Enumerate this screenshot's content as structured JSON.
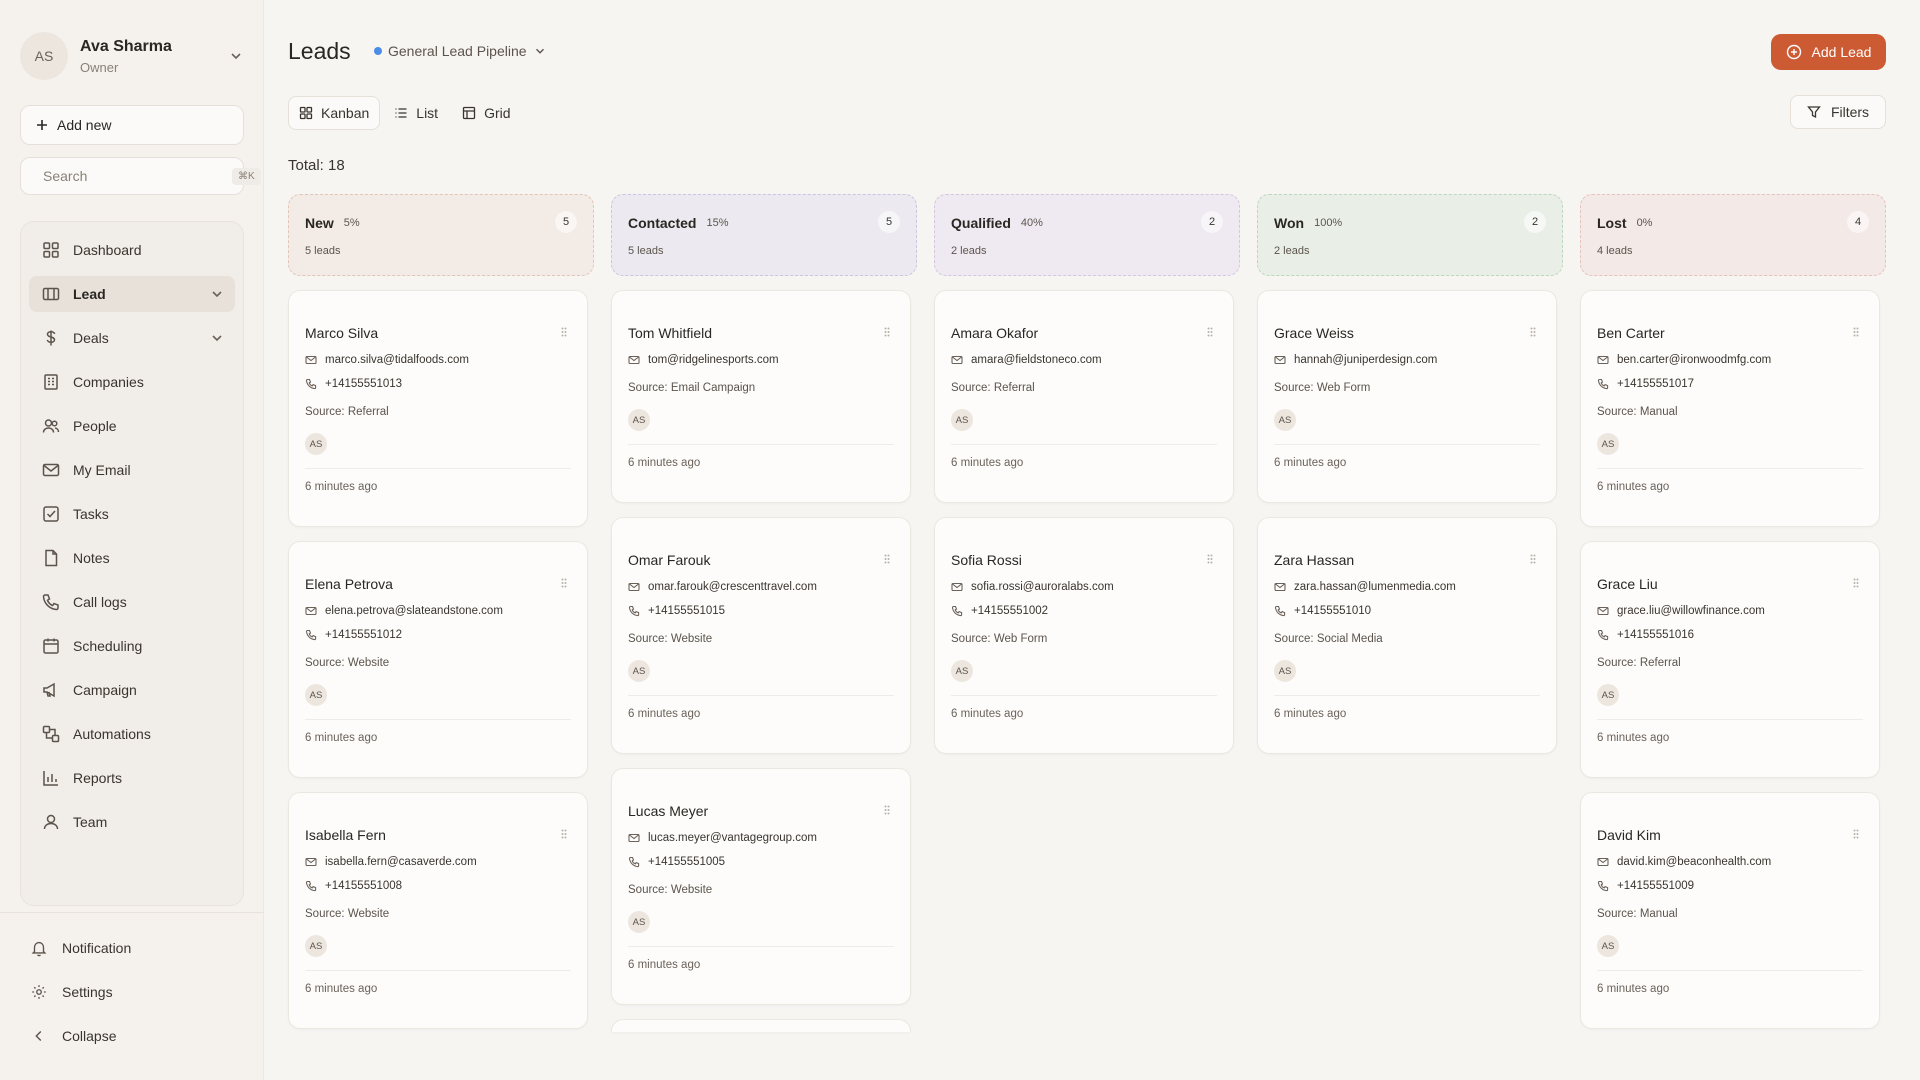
{
  "user": {
    "initials": "AS",
    "name": "Ava Sharma",
    "role": "Owner"
  },
  "sidebar": {
    "add_new": "Add new",
    "search_placeholder": "Search",
    "search_shortcut": "⌘K",
    "items": [
      {
        "label": "Dashboard",
        "icon": "grid-icon"
      },
      {
        "label": "Lead",
        "icon": "id-card-icon",
        "active": true,
        "expandable": true
      },
      {
        "label": "Deals",
        "icon": "dollar-icon",
        "expandable": true
      },
      {
        "label": "Companies",
        "icon": "building-icon"
      },
      {
        "label": "People",
        "icon": "people-icon"
      },
      {
        "label": "My Email",
        "icon": "mail-icon"
      },
      {
        "label": "Tasks",
        "icon": "check-square-icon"
      },
      {
        "label": "Notes",
        "icon": "file-icon"
      },
      {
        "label": "Call logs",
        "icon": "phone-icon"
      },
      {
        "label": "Scheduling",
        "icon": "calendar-icon"
      },
      {
        "label": "Campaign",
        "icon": "megaphone-icon"
      },
      {
        "label": "Automations",
        "icon": "workflow-icon"
      },
      {
        "label": "Reports",
        "icon": "bar-chart-icon"
      },
      {
        "label": "Team",
        "icon": "user-icon"
      }
    ],
    "bottom": {
      "notification": "Notification",
      "settings": "Settings",
      "collapse": "Collapse"
    }
  },
  "header": {
    "title": "Leads",
    "pipeline": "General Lead Pipeline",
    "add_lead": "Add Lead",
    "filters": "Filters",
    "views": [
      "Kanban",
      "List",
      "Grid"
    ],
    "total": "Total: 18"
  },
  "colors": {
    "accent": "#cc5a33",
    "pipeline_dot": "#4a8ce8"
  },
  "columns": [
    {
      "name": "New",
      "pct": "5%",
      "count": "5",
      "sub": "5 leads",
      "bg": "#f2ebe6",
      "border": "#e3c5b8",
      "cards": [
        {
          "name": "Marco Silva",
          "email": "marco.silva@tidalfoods.com",
          "phone": "+14155551013",
          "source": "Source: Referral",
          "owner": "AS",
          "time": "6 minutes ago"
        },
        {
          "name": "Elena Petrova",
          "email": "elena.petrova@slateandstone.com",
          "phone": "+14155551012",
          "source": "Source: Website",
          "owner": "AS",
          "time": "6 minutes ago"
        },
        {
          "name": "Isabella Fern",
          "email": "isabella.fern@casaverde.com",
          "phone": "+14155551008",
          "source": "Source: Website",
          "owner": "AS",
          "time": "6 minutes ago"
        }
      ]
    },
    {
      "name": "Contacted",
      "pct": "15%",
      "count": "5",
      "sub": "5 leads",
      "bg": "#eceaf0",
      "border": "#c9c6dd",
      "cards": [
        {
          "name": "Tom Whitfield",
          "email": "tom@ridgelinesports.com",
          "phone": "",
          "source": "Source: Email Campaign",
          "owner": "AS",
          "time": "6 minutes ago"
        },
        {
          "name": "Omar Farouk",
          "email": "omar.farouk@crescenttravel.com",
          "phone": "+14155551015",
          "source": "Source: Website",
          "owner": "AS",
          "time": "6 minutes ago"
        },
        {
          "name": "Lucas Meyer",
          "email": "lucas.meyer@vantagegroup.com",
          "phone": "+14155551005",
          "source": "Source: Website",
          "owner": "AS",
          "time": "6 minutes ago"
        }
      ]
    },
    {
      "name": "Qualified",
      "pct": "40%",
      "count": "2",
      "sub": "2 leads",
      "bg": "#efe9f1",
      "border": "#d6c5de",
      "cards": [
        {
          "name": "Amara Okafor",
          "email": "amara@fieldstoneco.com",
          "phone": "",
          "source": "Source: Referral",
          "owner": "AS",
          "time": "6 minutes ago"
        },
        {
          "name": "Sofia Rossi",
          "email": "sofia.rossi@auroralabs.com",
          "phone": "+14155551002",
          "source": "Source: Web Form",
          "owner": "AS",
          "time": "6 minutes ago"
        }
      ]
    },
    {
      "name": "Won",
      "pct": "100%",
      "count": "2",
      "sub": "2 leads",
      "bg": "#e9efe7",
      "border": "#bcd8bc",
      "cards": [
        {
          "name": "Grace Weiss",
          "email": "hannah@juniperdesign.com",
          "phone": "",
          "source": "Source: Web Form",
          "owner": "AS",
          "time": "6 minutes ago"
        },
        {
          "name": "Zara Hassan",
          "email": "zara.hassan@lumenmedia.com",
          "phone": "+14155551010",
          "source": "Source: Social Media",
          "owner": "AS",
          "time": "6 minutes ago"
        }
      ]
    },
    {
      "name": "Lost",
      "pct": "0%",
      "count": "4",
      "sub": "4 leads",
      "bg": "#f3e9e6",
      "border": "#e7c2bb",
      "cards": [
        {
          "name": "Ben Carter",
          "email": "ben.carter@ironwoodmfg.com",
          "phone": "+14155551017",
          "source": "Source: Manual",
          "owner": "AS",
          "time": "6 minutes ago"
        },
        {
          "name": "Grace Liu",
          "email": "grace.liu@willowfinance.com",
          "phone": "+14155551016",
          "source": "Source: Referral",
          "owner": "AS",
          "time": "6 minutes ago"
        },
        {
          "name": "David Kim",
          "email": "david.kim@beaconhealth.com",
          "phone": "+14155551009",
          "source": "Source: Manual",
          "owner": "AS",
          "time": "6 minutes ago"
        }
      ]
    }
  ]
}
